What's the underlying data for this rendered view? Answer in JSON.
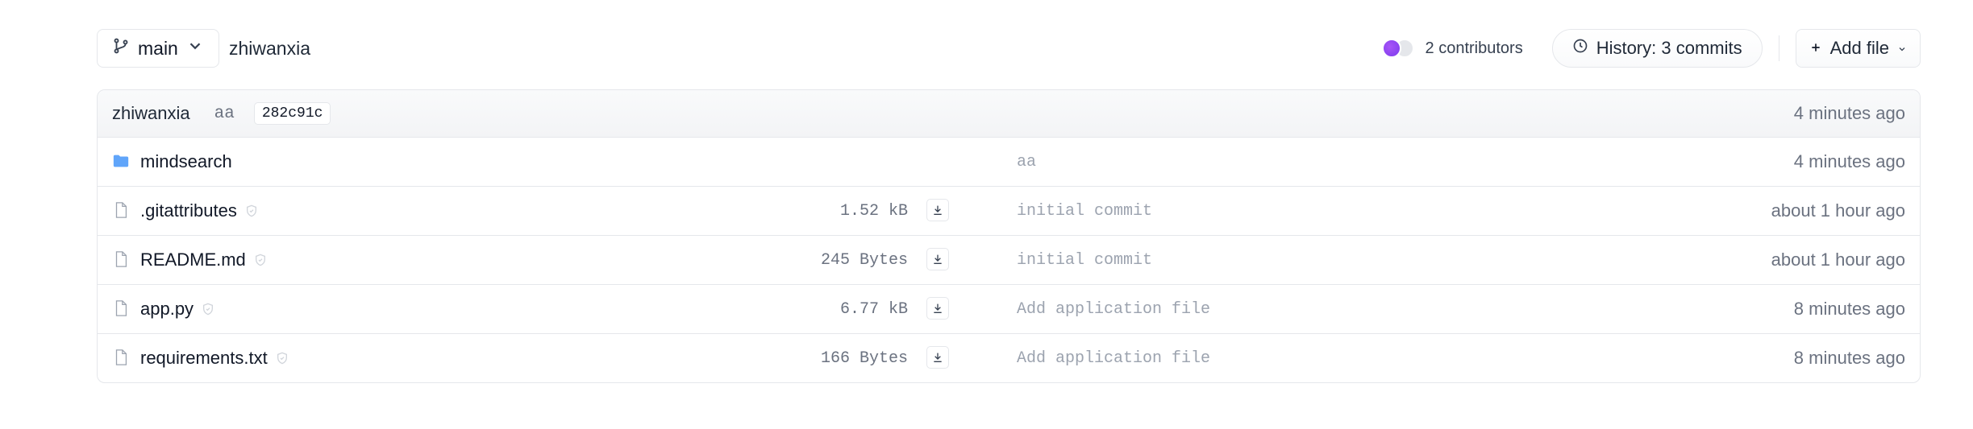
{
  "header": {
    "branch": "main",
    "repo_owner": "zhiwanxia",
    "contributors": "2 contributors",
    "history": "History: 3 commits",
    "add_file": "Add file"
  },
  "last_commit": {
    "author": "zhiwanxia",
    "message": "aa",
    "hash": "282c91c",
    "time": "4 minutes ago"
  },
  "files": [
    {
      "name": "mindsearch",
      "type": "folder",
      "size": "",
      "message": "aa",
      "time": "4 minutes ago"
    },
    {
      "name": ".gitattributes",
      "type": "file",
      "size": "1.52 kB",
      "message": "initial commit",
      "time": "about 1 hour ago"
    },
    {
      "name": "README.md",
      "type": "file",
      "size": "245 Bytes",
      "message": "initial commit",
      "time": "about 1 hour ago"
    },
    {
      "name": "app.py",
      "type": "file",
      "size": "6.77 kB",
      "message": "Add application file",
      "time": "8 minutes ago"
    },
    {
      "name": "requirements.txt",
      "type": "file",
      "size": "166 Bytes",
      "message": "Add application file",
      "time": "8 minutes ago"
    }
  ],
  "colors": {
    "folder": "#60a5fa",
    "avatar": "#8b5cf6",
    "border": "#e5e7eb",
    "muted_text": "#6b7280"
  }
}
